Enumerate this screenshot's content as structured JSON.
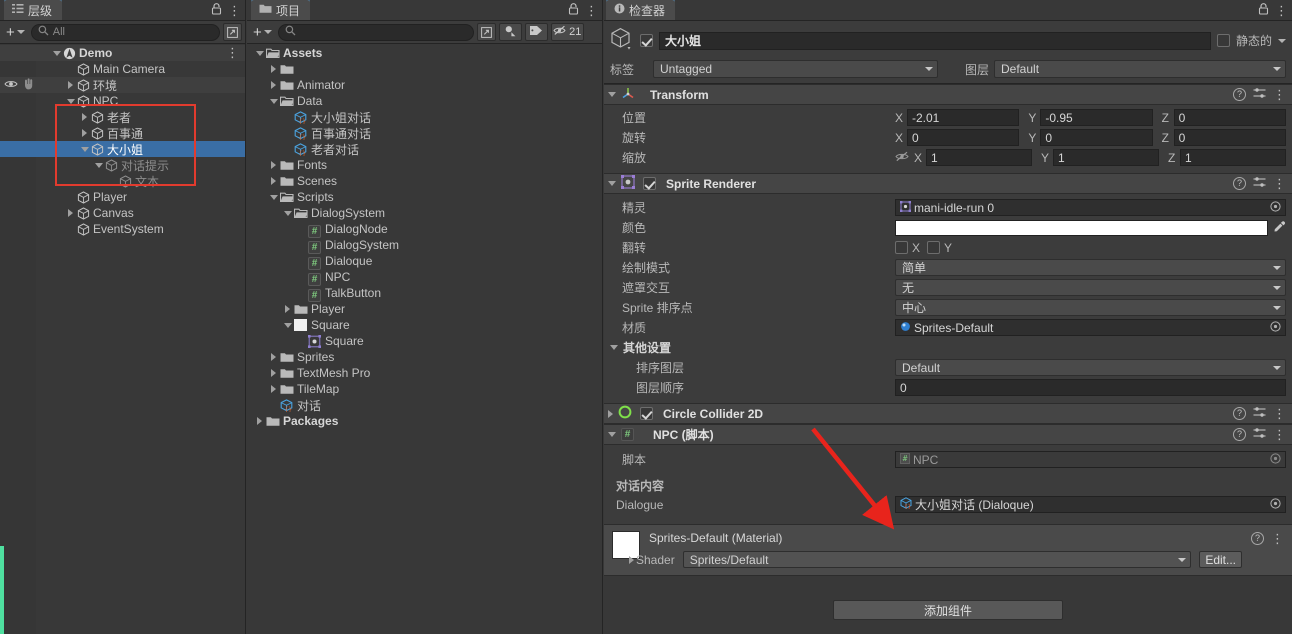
{
  "hierarchy": {
    "tab_label": "层级",
    "tab_icon": "hierarchy-icon",
    "lock_icon": "lock-icon",
    "menu_icon": "kebab-menu-icon",
    "add_label": "+",
    "search_placeholder": "All",
    "search_value": "",
    "items": [
      {
        "label": "Demo",
        "indent": 1,
        "twisty": "down",
        "icon": "scene-icon",
        "style": "bold",
        "selected": false,
        "row_alt": true,
        "kebab": true
      },
      {
        "label": "Main Camera",
        "indent": 2,
        "twisty": "none",
        "icon": "cube-icon",
        "style": "normal",
        "selected": false,
        "row_alt": false,
        "kebab": false
      },
      {
        "label": "环境",
        "indent": 2,
        "twisty": "right",
        "icon": "cube-icon",
        "style": "normal",
        "selected": false,
        "row_alt": true,
        "kebab": false,
        "eye": true
      },
      {
        "label": "NPC",
        "indent": 2,
        "twisty": "down",
        "icon": "cube-icon",
        "style": "normal",
        "selected": false,
        "row_alt": false,
        "kebab": false
      },
      {
        "label": "老者",
        "indent": 3,
        "twisty": "right",
        "icon": "cube-icon",
        "style": "normal",
        "selected": false,
        "row_alt": false,
        "kebab": false
      },
      {
        "label": "百事通",
        "indent": 3,
        "twisty": "right",
        "icon": "cube-icon",
        "style": "normal",
        "selected": false,
        "row_alt": false,
        "kebab": false
      },
      {
        "label": "大小姐",
        "indent": 3,
        "twisty": "down",
        "icon": "cube-icon",
        "style": "normal",
        "selected": true,
        "row_alt": false,
        "kebab": false
      },
      {
        "label": "对话提示",
        "indent": 4,
        "twisty": "down",
        "icon": "cube-icon",
        "style": "dim",
        "selected": false,
        "row_alt": false,
        "kebab": false
      },
      {
        "label": "文本",
        "indent": 5,
        "twisty": "none",
        "icon": "cube-icon",
        "style": "dim",
        "selected": false,
        "row_alt": false,
        "kebab": false
      },
      {
        "label": "Player",
        "indent": 2,
        "twisty": "none",
        "icon": "cube-icon",
        "style": "normal",
        "selected": false,
        "row_alt": false,
        "kebab": false
      },
      {
        "label": "Canvas",
        "indent": 2,
        "twisty": "right",
        "icon": "cube-icon",
        "style": "normal",
        "selected": false,
        "row_alt": false,
        "kebab": false
      },
      {
        "label": "EventSystem",
        "indent": 2,
        "twisty": "none",
        "icon": "cube-icon",
        "style": "normal",
        "selected": false,
        "row_alt": false,
        "kebab": false
      }
    ]
  },
  "project": {
    "tab_label": "项目",
    "tab_icon": "folder-icon",
    "lock_icon": "lock-icon",
    "menu_icon": "kebab-menu-icon",
    "add_label": "+",
    "search_placeholder": "",
    "search_value": "",
    "filter_type_icon": "object-filter-icon",
    "filter_label_icon": "tag-filter-icon",
    "hidden_count_icon": "hidden-eye-icon",
    "hidden_count": "21",
    "items": [
      {
        "label": "Assets",
        "indent": 0,
        "twisty": "down",
        "icon": "folder-open-icon",
        "style": "bold"
      },
      {
        "label": "",
        "indent": 1,
        "twisty": "right",
        "icon": "folder-icon",
        "style": "normal"
      },
      {
        "label": "Animator",
        "indent": 1,
        "twisty": "right",
        "icon": "folder-icon",
        "style": "normal"
      },
      {
        "label": "Data",
        "indent": 1,
        "twisty": "down",
        "icon": "folder-open-icon",
        "style": "normal"
      },
      {
        "label": "大小姐对话",
        "indent": 2,
        "twisty": "none",
        "icon": "scriptable-icon",
        "style": "normal"
      },
      {
        "label": "百事通对话",
        "indent": 2,
        "twisty": "none",
        "icon": "scriptable-icon",
        "style": "normal"
      },
      {
        "label": "老者对话",
        "indent": 2,
        "twisty": "none",
        "icon": "scriptable-icon",
        "style": "normal"
      },
      {
        "label": "Fonts",
        "indent": 1,
        "twisty": "right",
        "icon": "folder-icon",
        "style": "normal"
      },
      {
        "label": "Scenes",
        "indent": 1,
        "twisty": "right",
        "icon": "folder-icon",
        "style": "normal"
      },
      {
        "label": "Scripts",
        "indent": 1,
        "twisty": "down",
        "icon": "folder-open-icon",
        "style": "normal"
      },
      {
        "label": "DialogSystem",
        "indent": 2,
        "twisty": "down",
        "icon": "folder-open-icon",
        "style": "normal"
      },
      {
        "label": "DialogNode",
        "indent": 3,
        "twisty": "none",
        "icon": "cs-script-icon",
        "style": "normal"
      },
      {
        "label": "DialogSystem",
        "indent": 3,
        "twisty": "none",
        "icon": "cs-script-icon",
        "style": "normal"
      },
      {
        "label": "Dialoque",
        "indent": 3,
        "twisty": "none",
        "icon": "cs-script-icon",
        "style": "normal"
      },
      {
        "label": "NPC",
        "indent": 3,
        "twisty": "none",
        "icon": "cs-script-icon",
        "style": "normal"
      },
      {
        "label": "TalkButton",
        "indent": 3,
        "twisty": "none",
        "icon": "cs-script-icon",
        "style": "normal"
      },
      {
        "label": "Player",
        "indent": 2,
        "twisty": "right",
        "icon": "folder-icon",
        "style": "normal"
      },
      {
        "label": "Square",
        "indent": 2,
        "twisty": "down",
        "icon": "texture-icon",
        "style": "normal"
      },
      {
        "label": "Square",
        "indent": 3,
        "twisty": "none",
        "icon": "sprite-icon",
        "style": "normal"
      },
      {
        "label": "Sprites",
        "indent": 1,
        "twisty": "right",
        "icon": "folder-icon",
        "style": "normal"
      },
      {
        "label": "TextMesh Pro",
        "indent": 1,
        "twisty": "right",
        "icon": "folder-icon",
        "style": "normal"
      },
      {
        "label": "TileMap",
        "indent": 1,
        "twisty": "right",
        "icon": "folder-icon",
        "style": "normal"
      },
      {
        "label": "对话",
        "indent": 1,
        "twisty": "none",
        "icon": "scriptable-icon",
        "style": "normal"
      },
      {
        "label": "Packages",
        "indent": 0,
        "twisty": "right",
        "icon": "folder-icon",
        "style": "bold"
      }
    ]
  },
  "inspector": {
    "tab_label": "检查器",
    "tab_icon": "info-icon",
    "lock_icon": "lock-icon",
    "menu_icon": "kebab-menu-icon",
    "object_icon": "gameobject-cube-icon",
    "enabled": true,
    "name_value": "大小姐",
    "static_label": "静态的",
    "static_checked": false,
    "tag_label": "标签",
    "tag_value": "Untagged",
    "layer_label": "图层",
    "layer_value": "Default",
    "transform": {
      "title": "Transform",
      "icon": "transform-axis-icon",
      "rows": [
        {
          "label": "位置",
          "x": "-2.01",
          "y": "-0.95",
          "z": "0",
          "link_icon": ""
        },
        {
          "label": "旋转",
          "x": "0",
          "y": "0",
          "z": "0",
          "link_icon": ""
        },
        {
          "label": "缩放",
          "x": "1",
          "y": "1",
          "z": "1",
          "link_icon": "constrain-proportions-off-icon"
        }
      ],
      "axis_labels": [
        "X",
        "Y",
        "Z"
      ]
    },
    "sprite_renderer": {
      "title": "Sprite Renderer",
      "icon": "sprite-renderer-icon",
      "enabled": true,
      "sprite_label": "精灵",
      "sprite_value": "mani-idle-run 0",
      "sprite_value_icon": "sprite-icon",
      "color_label": "颜色",
      "color_value": "#FFFFFF",
      "color_picker_icon": "eyedropper-icon",
      "flip_label": "翻转",
      "flip_x_label": "X",
      "flip_y_label": "Y",
      "flip_x": false,
      "flip_y": false,
      "draw_mode_label": "绘制模式",
      "draw_mode_value": "简单",
      "mask_label": "遮罩交互",
      "mask_value": "无",
      "sort_point_label": "Sprite 排序点",
      "sort_point_value": "中心",
      "material_label": "材质",
      "material_value": "Sprites-Default",
      "material_icon": "material-sphere-icon",
      "extra_section_label": "其他设置",
      "sorting_layer_label": "排序图层",
      "sorting_layer_value": "Default",
      "order_label": "图层顺序",
      "order_value": "0"
    },
    "circle_collider": {
      "title": "Circle Collider 2D",
      "icon": "circle-collider-icon",
      "enabled": true
    },
    "npc_script": {
      "title": "NPC   (脚本)",
      "icon": "cs-script-icon",
      "script_label": "脚本",
      "script_value": "NPC",
      "script_value_icon": "cs-script-icon",
      "section_label": "对话内容",
      "dialogue_label": "Dialogue",
      "dialogue_value": "大小姐对话 (Dialoque)",
      "dialogue_value_icon": "scriptable-icon"
    },
    "material_preview": {
      "title": "Sprites-Default (Material)",
      "swatch_color": "#FFFFFF",
      "shader_label": "Shader",
      "shader_value": "Sprites/Default",
      "edit_label": "Edit..."
    },
    "add_component_label": "添加组件"
  },
  "annotations": {
    "highlight_box_color": "#e23b2e",
    "arrow_color": "#e8241c",
    "accent_green": "#4fe0a0"
  }
}
